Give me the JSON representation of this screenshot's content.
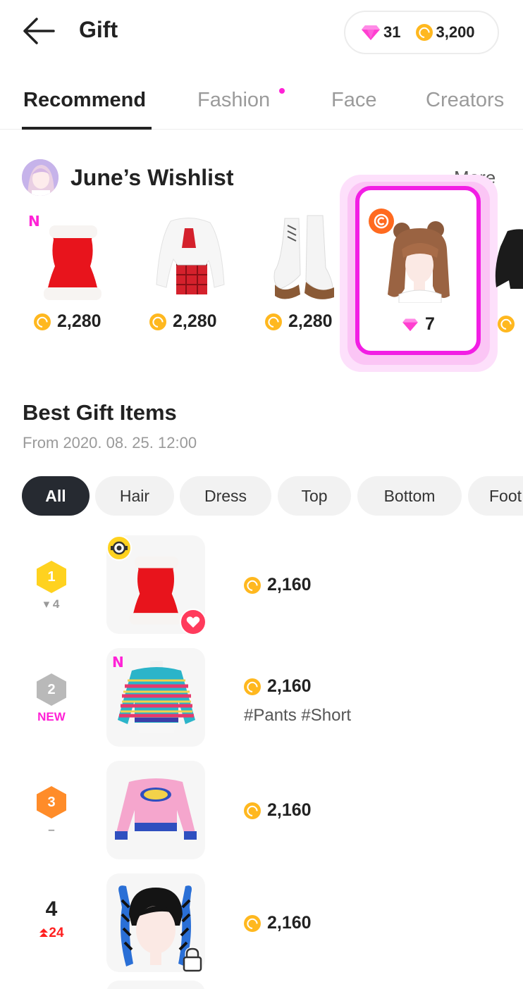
{
  "header": {
    "title": "Gift",
    "back_icon": "arrow-left-icon",
    "gems": "31",
    "coins": "3,200"
  },
  "tabs": [
    {
      "label": "Recommend",
      "active": true
    },
    {
      "label": "Fashion",
      "has_dot": true
    },
    {
      "label": "Face"
    },
    {
      "label": "Creators"
    }
  ],
  "wishlist": {
    "title": "June’s Wishlist",
    "more": "More",
    "items": [
      {
        "item": "red-fur-trim-dress",
        "badge": "N",
        "currency": "coin",
        "price": "2,280"
      },
      {
        "item": "white-jacket-red-plaid-outfit",
        "currency": "coin",
        "price": "2,280"
      },
      {
        "item": "white-platform-boots",
        "currency": "coin",
        "price": "2,280"
      },
      {
        "item": "brown-bun-hair",
        "currency": "gem",
        "price": "7",
        "highlighted": true,
        "creator_badge": "creator-c-icon"
      }
    ]
  },
  "best": {
    "title": "Best Gift Items",
    "subtitle": "From 2020. 08. 25. 12:00",
    "chips": [
      "All",
      "Hair",
      "Dress",
      "Top",
      "Bottom",
      "Foot"
    ],
    "active_chip": "All",
    "items": [
      {
        "rank": "1",
        "medal": "gold",
        "change": "▾ 4",
        "item": "red-fur-trim-dress",
        "price": "2,160",
        "tags": "",
        "badge": "eye-icon",
        "liked": true
      },
      {
        "rank": "2",
        "medal": "silver",
        "change": "NEW",
        "item": "striped-crop-sweater",
        "price": "2,160",
        "tags": "#Pants #Short",
        "badge": "N"
      },
      {
        "rank": "3",
        "medal": "bronze",
        "change": "–",
        "item": "pink-love-mode-crop-top",
        "price": "2,160",
        "tags": ""
      },
      {
        "rank": "4",
        "medal": "none",
        "change": "24",
        "item": "blue-braid-pigtails-hair",
        "price": "2,160",
        "tags": "",
        "locked": true
      }
    ]
  },
  "colors": {
    "accent_pink": "#f21ee4",
    "coin": "#ffb81f",
    "gem": "#ff3fd0",
    "dark_chip": "#262a31"
  }
}
